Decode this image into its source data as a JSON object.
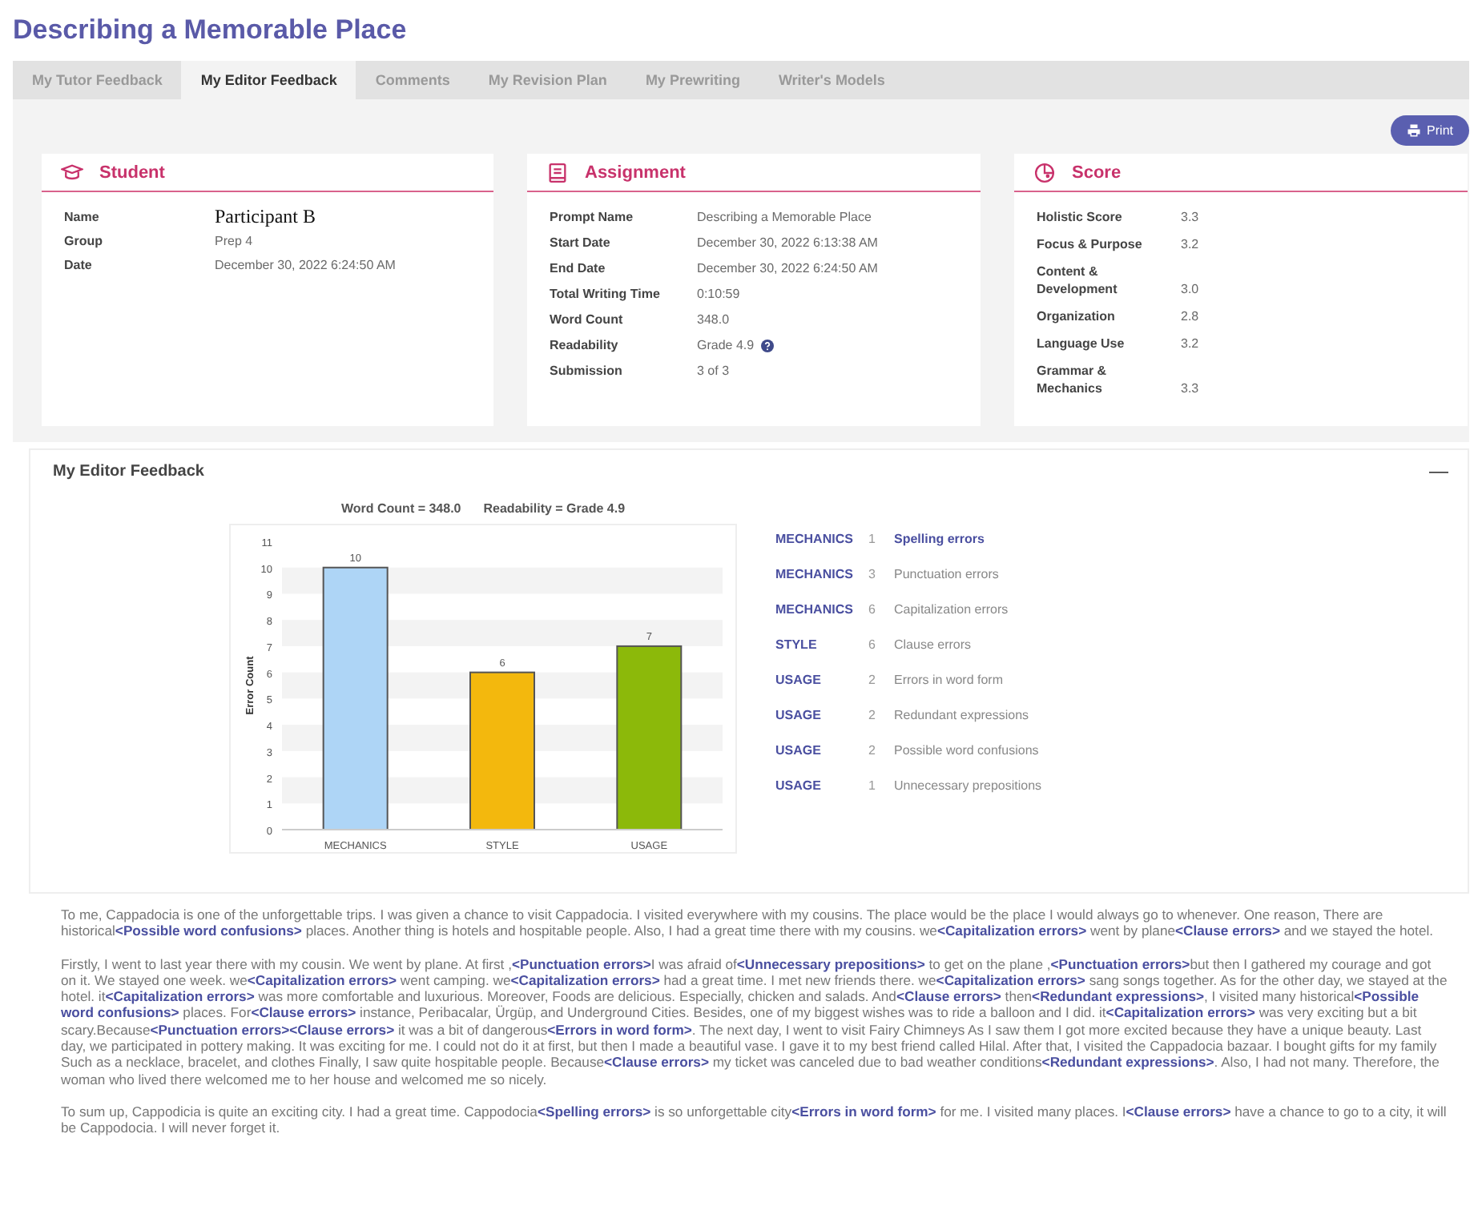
{
  "title": "Describing a Memorable Place",
  "tabs": [
    {
      "label": "My Tutor Feedback",
      "selected": false
    },
    {
      "label": "My Editor Feedback",
      "selected": true
    },
    {
      "label": "Comments",
      "selected": false
    },
    {
      "label": "My Revision Plan",
      "selected": false
    },
    {
      "label": "My Prewriting",
      "selected": false
    },
    {
      "label": "Writer's Models",
      "selected": false
    }
  ],
  "print_button": "Print",
  "cards": [
    {
      "kind": "student",
      "title": "Student",
      "rows": [
        {
          "label": "Name",
          "value": "Participant B",
          "kind": "name"
        },
        {
          "label": "Group",
          "value": "Prep 4"
        },
        {
          "label": "Date",
          "value": "December 30, 2022 6:24:50 AM"
        }
      ]
    },
    {
      "kind": "assignment",
      "title": "Assignment",
      "rows": [
        {
          "label": "Prompt Name",
          "value": "Describing a Memorable Place"
        },
        {
          "label": "Start Date",
          "value": "December 30, 2022 6:13:38 AM"
        },
        {
          "label": "End Date",
          "value": "December 30, 2022 6:24:50 AM"
        },
        {
          "label": "Total Writing Time",
          "value": "0:10:59"
        },
        {
          "label": "Word Count",
          "value": "348.0"
        },
        {
          "label": "Readability",
          "value": "Grade 4.9",
          "kind": "help"
        },
        {
          "label": "Submission",
          "value": "3 of 3"
        }
      ]
    },
    {
      "kind": "score",
      "title": "Score",
      "rows": [
        {
          "label": "Holistic Score",
          "value": "3.3"
        },
        {
          "label": "Focus & Purpose",
          "value": "3.2"
        },
        {
          "label": "Content & Development",
          "value": "3.0"
        },
        {
          "label": "Organization",
          "value": "2.8"
        },
        {
          "label": "Language Use",
          "value": "3.2"
        },
        {
          "label": "Grammar & Mechanics",
          "value": "3.3"
        }
      ]
    }
  ],
  "feedback": {
    "title": "My Editor Feedback",
    "collapse": "—",
    "chart_data": {
      "type": "bar",
      "title": "Word Count = 348.0",
      "subtitle": "Readability = Grade 4.9",
      "ylabel": "Error Count",
      "categories": [
        "MECHANICS",
        "STYLE",
        "USAGE"
      ],
      "colors": [
        "#aed5f6",
        "#f3b80d",
        "#8cb90a"
      ],
      "series": [
        {
          "values": [
            10,
            6,
            7
          ]
        }
      ],
      "ylim": [
        0,
        11
      ],
      "yticks": [
        0,
        1,
        2,
        3,
        4,
        5,
        6,
        7,
        8,
        9,
        10,
        11
      ],
      "data_labels": true
    },
    "errors": [
      {
        "category": "MECHANICS",
        "count": "1",
        "name": "Spelling errors",
        "selected": true
      },
      {
        "category": "MECHANICS",
        "count": "3",
        "name": "Punctuation errors",
        "selected": false
      },
      {
        "category": "MECHANICS",
        "count": "6",
        "name": "Capitalization errors",
        "selected": false
      },
      {
        "category": "STYLE",
        "count": "6",
        "name": "Clause errors",
        "selected": false
      },
      {
        "category": "USAGE",
        "count": "2",
        "name": "Errors in word form",
        "selected": false
      },
      {
        "category": "USAGE",
        "count": "2",
        "name": "Redundant expressions",
        "selected": false
      },
      {
        "category": "USAGE",
        "count": "2",
        "name": "Possible word confusions",
        "selected": false
      },
      {
        "category": "USAGE",
        "count": "1",
        "name": "Unnecessary prepositions",
        "selected": false
      }
    ]
  },
  "essay": [
    "To me, Cappadocia is one of the unforgettable trips. I was given a chance to visit Cappadocia. I visited everywhere with my cousins. The place would be the place I would always go to whenever. One reason, There are historical**<Possible word confusions>** places. Another thing is hotels and hospitable people. Also, I had a great time there with my cousins. we**<Capitalization errors>** went by plane**<Clause errors>** and we stayed the hotel.",
    "Firstly, I went to last year there with my cousin. We went by plane. At first ,**<Punctuation errors>**I was afraid of**<Unnecessary prepositions>** to get on the plane ,**<Punctuation errors>**but then I gathered my courage and got on it. We stayed one week. we**<Capitalization errors>** went camping. we**<Capitalization errors>** had a great time. I met new friends there. we**<Capitalization errors>** sang songs together. As for the other day, we stayed at the hotel. it**<Capitalization errors>** was more comfortable and luxurious. Moreover, Foods are delicious. Especially, chicken and salads. And**<Clause errors>** then**<Redundant expressions>**, I visited many historical**<Possible word confusions>** places. For**<Clause errors>** instance, Peribacalar, Ürgüp, and Underground Cities. Besides, one of my biggest wishes was to ride a balloon and I did. it**<Capitalization errors>** was very exciting but a bit scary.Because**<Punctuation errors><Clause errors>** it was a bit of dangerous**<Errors in word form>**. The next day, I went to visit Fairy Chimneys As I saw them I got more excited because they have a unique beauty. Last day, we participated in pottery making. It was exciting for me. I could not do it at first, but then I made a beautiful vase. I gave it to my best friend called Hilal. After that, I visited the Cappadocia bazaar. I bought gifts for my family Such as a necklace, bracelet, and clothes Finally, I saw quite hospitable people. Because**<Clause errors>** my ticket was canceled due to bad weather conditions**<Redundant expressions>**. Also, I had not many. Therefore, the woman who lived there welcomed me to her house and welcomed me so nicely.",
    "To sum up, Cappodicia is quite an exciting city. I had a great time. Cappodocia**<Spelling errors>** is so unforgettable city**<Errors in word form>** for me. I visited many places. I**<Clause errors>** have a chance to go to a city, it will be Cappodocia. I will never forget it."
  ]
}
